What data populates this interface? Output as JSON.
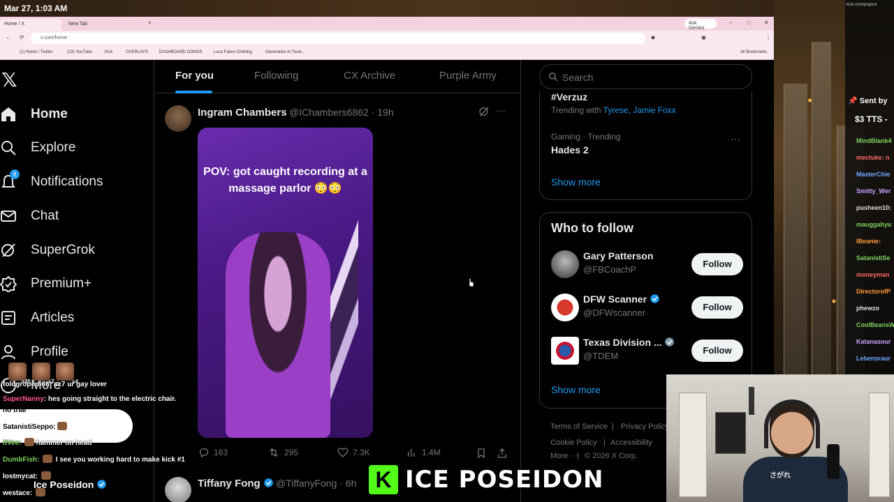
{
  "clock": "Mar 27, 1:03 AM",
  "browser": {
    "tabs": [
      {
        "label": "Home / X"
      },
      {
        "label": "New Tab"
      }
    ],
    "ask_label": "Ask Gemini",
    "url": "x.com/home",
    "bookmarks": [
      "(1) Home / Twitter",
      "(23) YouTube",
      "Kick",
      "OVERLAYS",
      "DASHBOARD DONOS",
      "Luca Faloni Clothing",
      "Generative AI Tools..."
    ],
    "all_bookmarks": "All Bookmarks"
  },
  "nav": {
    "items": [
      {
        "label": "Home",
        "icon": "home-icon",
        "bold": true
      },
      {
        "label": "Explore",
        "icon": "search-icon"
      },
      {
        "label": "Notifications",
        "icon": "bell-icon",
        "badge": "8"
      },
      {
        "label": "Chat",
        "icon": "mail-icon"
      },
      {
        "label": "SuperGrok",
        "icon": "grok-icon"
      },
      {
        "label": "Premium+",
        "icon": "verified-badge-icon"
      },
      {
        "label": "Articles",
        "icon": "article-icon"
      },
      {
        "label": "Profile",
        "icon": "person-icon"
      },
      {
        "label": "More",
        "icon": "more-circle-icon"
      }
    ]
  },
  "timeline_tabs": [
    "For you",
    "Following",
    "CX Archive",
    "Purple Army"
  ],
  "post": {
    "name": "Ingram Chambers",
    "handle": "@IChambers6862 · 19h",
    "caption": "POV: got caught recording at a massage parlor 😳😳",
    "replies": "163",
    "reposts": "295",
    "likes": "7.3K",
    "views": "1.4M"
  },
  "post2": {
    "name": "Tiffany Fong",
    "handle": "@TiffanyFong · 6h"
  },
  "search": {
    "placeholder": "Search"
  },
  "trends": {
    "top_tag": "#Verzuz",
    "trending_with_prefix": "Trending with ",
    "trending_with": "Tyrese, Jamie Foxx",
    "category": "Gaming · Trending",
    "name": "Hades 2",
    "show_more": "Show more"
  },
  "who_to_follow": {
    "title": "Who to follow",
    "accounts": [
      {
        "name": "Gary Patterson",
        "handle": "@FBCoachP",
        "verified": false
      },
      {
        "name": "DFW Scanner",
        "handle": "@DFWscanner",
        "verified": true
      },
      {
        "name": "Texas Division ...",
        "handle": "@TDEM",
        "verified": true
      }
    ],
    "follow_label": "Follow",
    "show_more": "Show more"
  },
  "footer": {
    "links": [
      "Terms of Service",
      "Privacy Policy",
      "Cookie Policy",
      "Accessibility",
      "More ···",
      "© 2026 X Corp."
    ]
  },
  "stream_chat": {
    "url": "kick.com/popout",
    "sent_by": "Sent by",
    "tts": "$3 TTS -",
    "lines": [
      {
        "user": "MindBlank4",
        "color": "#7fd35f"
      },
      {
        "user": "mectuke: n",
        "color": "#ff6a6a"
      },
      {
        "user": "MasterChie",
        "color": "#6fa8ff"
      },
      {
        "user": "Smitty_Wer",
        "color": "#c9a3ff"
      },
      {
        "user": "pusheen10:",
        "color": "#e0e0e0"
      },
      {
        "user": "mauggahyu",
        "color": "#7fd35f"
      },
      {
        "user": "IBeanie:",
        "color": "#ff9b3d"
      },
      {
        "user": "SatanistiSe",
        "color": "#7fd35f"
      },
      {
        "user": "moneyman",
        "color": "#ff6a6a"
      },
      {
        "user": "DirectorofP",
        "color": "#ff9b3d"
      },
      {
        "user": "phewzo",
        "color": "#e0e0e0"
      },
      {
        "user": "CoolBeansW",
        "color": "#7fd35f"
      },
      {
        "user": "Katanasour",
        "color": "#c9a3ff"
      },
      {
        "user": "Lebensraur",
        "color": "#6fa8ff"
      }
    ]
  },
  "left_chat": {
    "counts": [
      "x45",
      "x7",
      "x4"
    ],
    "lines": [
      {
        "user": "foldgroper666",
        "text": ": ac7 ur gay lover",
        "color": "#fff"
      },
      {
        "user": "SuperNanny",
        "text": ": hes going straight to the electric chair.",
        "color": "#ff5a8a"
      },
      {
        "user": "",
        "text": "no trial",
        "color": "#fff"
      },
      {
        "user": "SatanistiSeppo:",
        "text": "",
        "color": "#000"
      },
      {
        "user": "itVee:",
        "text": "hammer on head",
        "color": "#7fd35f"
      },
      {
        "user": "DumbFish:",
        "text": "I see you working hard to make kick #1",
        "color": "#7fd35f"
      },
      {
        "user": "lostmycat:",
        "text": "",
        "color": "#fff"
      },
      {
        "user": "westace:",
        "text": "",
        "color": "#fff"
      }
    ],
    "ice_label": "Ice Poseidon"
  },
  "webcam": {
    "shirt_text": "さがれ"
  },
  "banner": {
    "k": "K",
    "text": "ICE POSEIDON"
  }
}
